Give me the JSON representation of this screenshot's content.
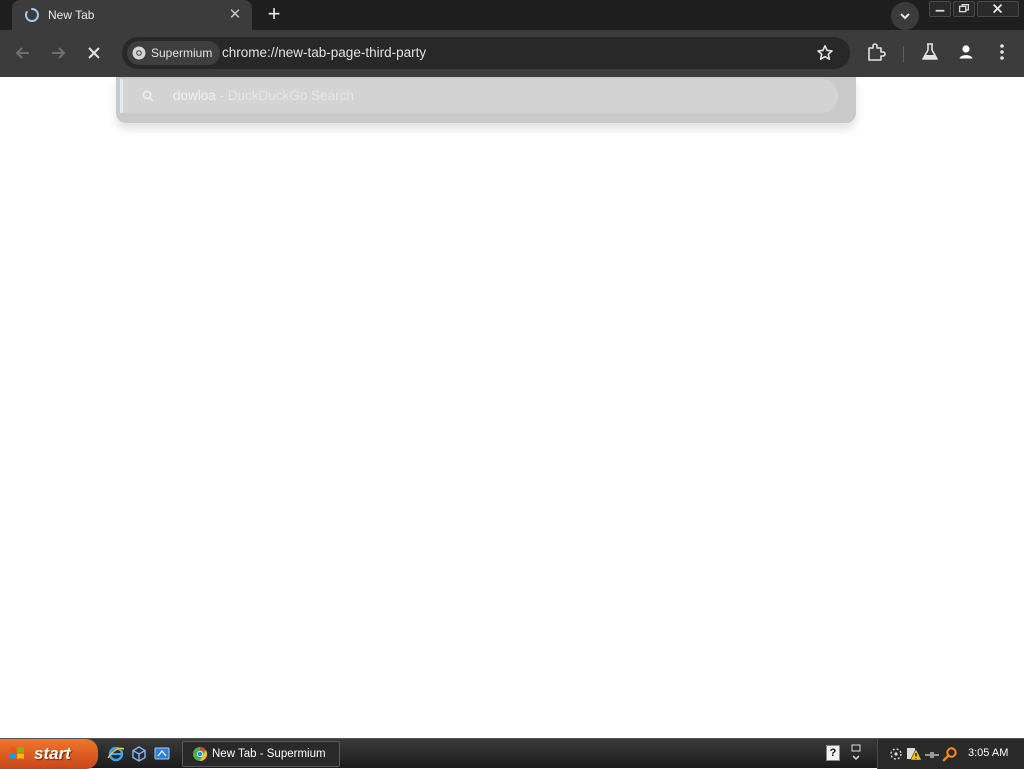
{
  "tab": {
    "title": "New Tab"
  },
  "omnibox": {
    "site_chip": "Supermium",
    "url": "chrome://new-tab-page-third-party"
  },
  "suggestion": {
    "query": "dowloa",
    "engine": " - DuckDuckGo Search"
  },
  "taskbar": {
    "start_label": "start",
    "task_label": "New Tab - Supermium",
    "help_glyph": "?",
    "clock": "3:05 AM"
  },
  "icons": {
    "tab": "loading-spinner-icon",
    "tab_close": "close-icon",
    "new_tab": "plus-icon",
    "tab_search": "chevron-down-icon",
    "back": "arrow-left-icon",
    "forward": "arrow-right-icon",
    "stop": "close-icon",
    "site": "browser-logo-icon",
    "bookmark": "star-outline-icon",
    "extensions": "puzzle-piece-icon",
    "labs": "flask-icon",
    "profile": "person-icon",
    "menu": "kebab-menu-icon",
    "suggestion": "search-icon"
  },
  "colors": {
    "tabstrip": "#1f1f1f",
    "toolbar": "#3c3c3c",
    "omnibox": "#282828",
    "start_button": "#e0602a"
  }
}
